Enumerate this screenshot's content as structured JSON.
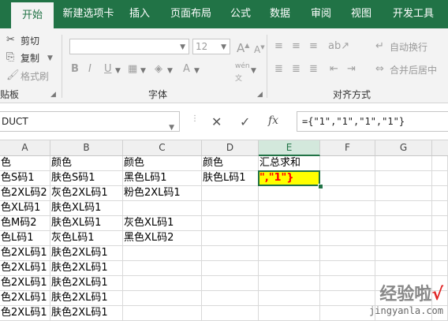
{
  "tabs": [
    "开始",
    "新建选项卡",
    "插入",
    "页面布局",
    "公式",
    "数据",
    "审阅",
    "视图",
    "开发工具"
  ],
  "clipboard": {
    "cut": "剪切",
    "copy": "复制",
    "format_painter": "格式刷",
    "group_label": "贴板"
  },
  "font": {
    "size": "12",
    "group_label": "字体",
    "wen_glyph": "wén"
  },
  "alignment": {
    "wrap_text": "自动换行",
    "merge_center": "合并后居中",
    "group_label": "对齐方式"
  },
  "formula_bar": {
    "name_box": "DUCT",
    "fx": "fx",
    "formula": "={\"1\",\"1\",\"1\",\"1\"}"
  },
  "columns": [
    "A",
    "B",
    "C",
    "D",
    "E",
    "F",
    "G"
  ],
  "rows": [
    [
      "色",
      "颜色",
      "颜色",
      "颜色",
      "汇总求和"
    ],
    [
      "色S码1",
      "肤色S码1",
      "黑色L码1",
      "肤色L码1",
      "\",\"1\"}"
    ],
    [
      "色2XL码2",
      "灰色2XL码1",
      "粉色2XL码1",
      "",
      ""
    ],
    [
      "色XL码1",
      "肤色XL码1",
      "",
      "",
      ""
    ],
    [
      "色M码2",
      "肤色XL码1",
      "灰色XL码1",
      "",
      ""
    ],
    [
      "色L码1",
      "灰色L码1",
      "黑色XL码2",
      "",
      ""
    ],
    [
      "色2XL码1",
      "肤色2XL码1",
      "",
      "",
      ""
    ],
    [
      "色2XL码1",
      "肤色2XL码1",
      "",
      "",
      ""
    ],
    [
      "色2XL码1",
      "肤色2XL码1",
      "",
      "",
      ""
    ],
    [
      "色2XL码1",
      "肤色2XL码1",
      "",
      "",
      ""
    ],
    [
      "色2XL码1",
      "肤色2XL码1",
      "",
      "",
      ""
    ]
  ],
  "selected_cell": "E2",
  "colors": {
    "ribbon_green": "#217346",
    "highlight_fill": "#ffff00",
    "highlight_text": "#ff0000"
  },
  "watermark": {
    "text": "经验啦",
    "check": "√",
    "url": "jingyanla.com"
  }
}
